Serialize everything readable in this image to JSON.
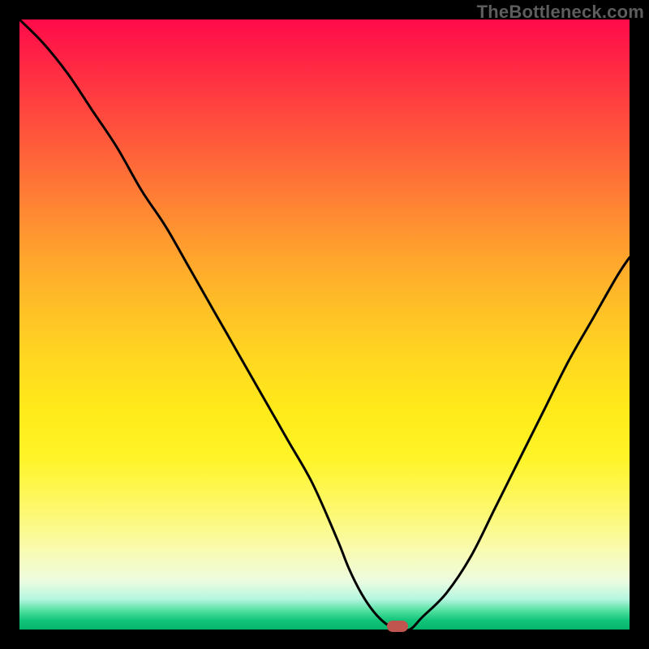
{
  "watermark": "TheBottleneck.com",
  "colors": {
    "frame": "#000000",
    "curve": "#000000",
    "marker": "#c0554f",
    "gradient_top": "#ff0a4a",
    "gradient_bottom": "#06b46c"
  },
  "chart_data": {
    "type": "line",
    "title": "",
    "xlabel": "",
    "ylabel": "",
    "xlim": [
      0,
      100
    ],
    "ylim": [
      0,
      100
    ],
    "grid": false,
    "legend": false,
    "series": [
      {
        "name": "bottleneck-curve",
        "x": [
          0,
          4,
          8,
          12,
          16,
          20,
          24,
          28,
          32,
          36,
          40,
          44,
          48,
          52,
          54,
          56,
          58,
          60,
          62,
          64,
          66,
          70,
          74,
          78,
          82,
          86,
          90,
          94,
          98,
          100
        ],
        "values": [
          100,
          96,
          91,
          85,
          79,
          72,
          66,
          59,
          52,
          45,
          38,
          31,
          24,
          15,
          10,
          6,
          3,
          1,
          0,
          0,
          2,
          6,
          12,
          20,
          28,
          36,
          44,
          51,
          58,
          61
        ]
      }
    ],
    "annotations": [
      {
        "name": "minimum-marker",
        "x": 62,
        "y": 0
      }
    ]
  }
}
